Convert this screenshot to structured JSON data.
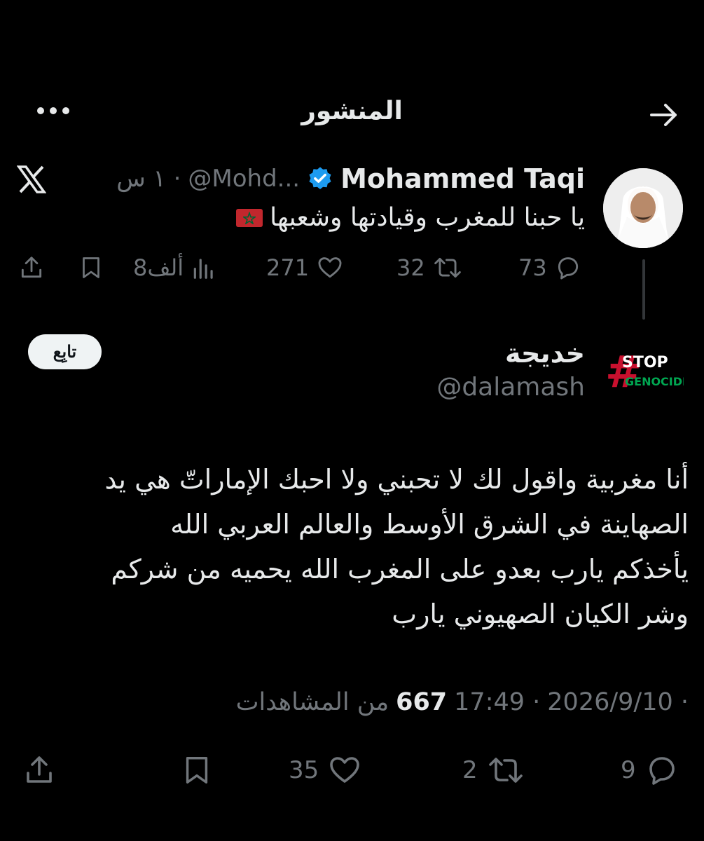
{
  "header": {
    "title": "المنشور",
    "back_icon": "arrow-right-icon",
    "more_icon": "more-horizontal-icon"
  },
  "parent_tweet": {
    "name": "Mohammed Taqi",
    "verified": true,
    "handle": "@Mohd...",
    "time": "١ س ·",
    "text": "يا حبنا للمغرب وقيادتها وشعبها",
    "flag_icon": "morocco-flag-icon",
    "stats": {
      "replies": "73",
      "retweets": "32",
      "likes": "271",
      "views": "8ألف"
    }
  },
  "main_tweet": {
    "name": "خديجة",
    "handle": "@dalamash",
    "avatar_label": {
      "hash": "#",
      "line1": "STOP",
      "line2": "GENOCIDE"
    },
    "follow_label": "تابِع",
    "text_lines": [
      "أنا مغربية واقول لك لا تحبني ولا احبك الإماراتّ هي يد",
      "الصهاينة في الشرق الأوسط والعالم العربي الله",
      "يأخذكم يارب بعدو على المغرب الله يحميه من شركم",
      "وشر الكيان الصهيوني يارب"
    ],
    "date": "2026/9/10 ·",
    "time": "17:49 ·",
    "views_count": "667",
    "views_label": "من المشاهدات",
    "stats": {
      "replies": "9",
      "retweets": "2",
      "likes": "35"
    }
  },
  "colors": {
    "background": "#000000",
    "text": "#e7e9ea",
    "secondary": "#71767b",
    "verified": "#1d9bf0",
    "stop_red": "#c8102e",
    "stop_green": "#00a651"
  }
}
